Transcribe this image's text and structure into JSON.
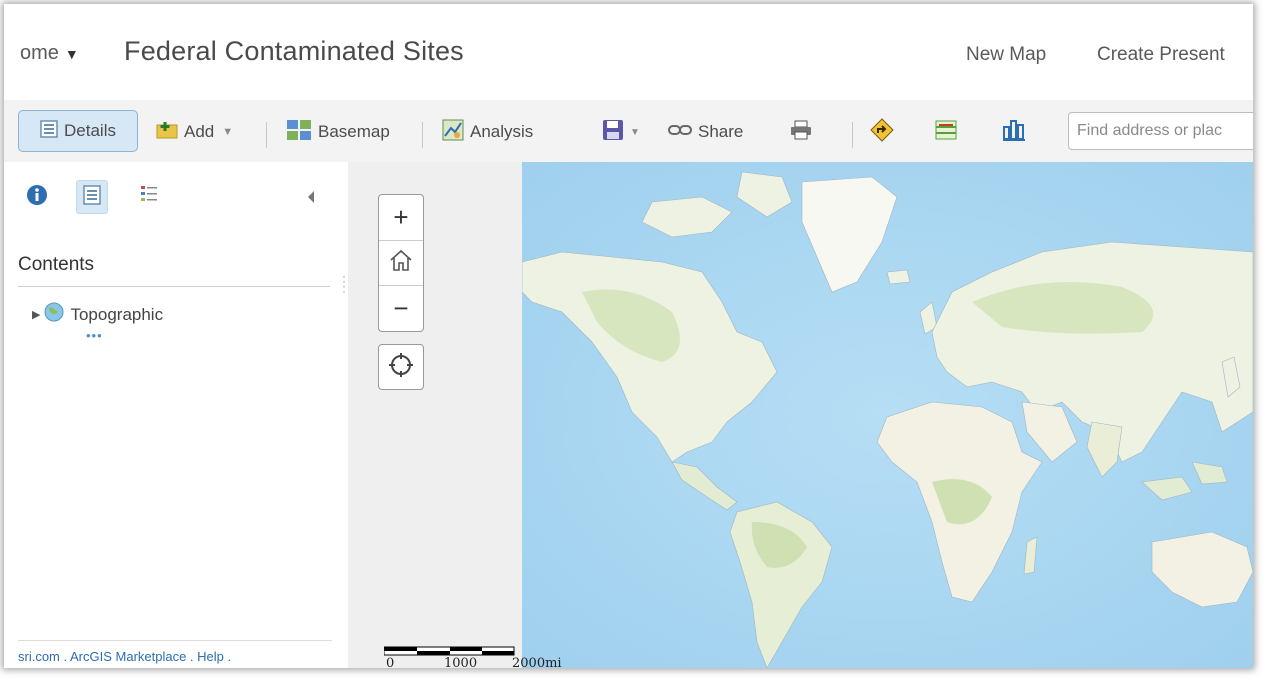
{
  "header": {
    "home_label": "ome",
    "home_caret": "▼",
    "title": "Federal Contaminated Sites",
    "new_map": "New Map",
    "create_presentation": "Create Present"
  },
  "toolbar": {
    "details": "Details",
    "add": "Add",
    "basemap": "Basemap",
    "analysis": "Analysis",
    "share": "Share",
    "search_placeholder": "Find address or plac"
  },
  "panel": {
    "contents_heading": "Contents",
    "layers": [
      {
        "name": "Topographic"
      }
    ],
    "layer_more": "•••",
    "footer": "sri.com . ArcGIS Marketplace . Help ."
  },
  "map": {
    "zoom_in": "+",
    "zoom_out": "−",
    "scale_labels": [
      "0",
      "1000",
      "2000mi"
    ]
  },
  "colors": {
    "accent_blue": "#2d6db1",
    "selected_bg": "#d6e7f6",
    "water": "#a9d5f0",
    "land": "#eef2e2"
  }
}
